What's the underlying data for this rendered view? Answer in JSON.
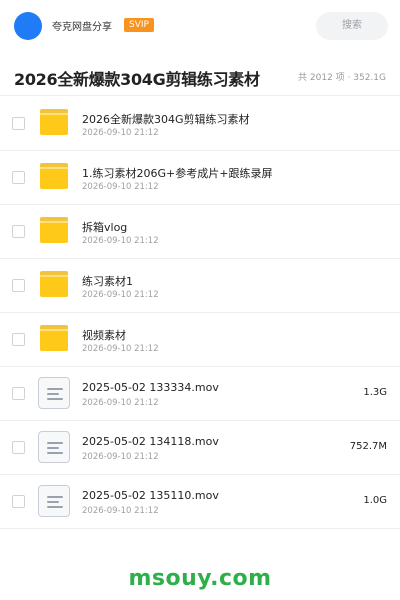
{
  "header": {
    "share_name": "夸克网盘分享",
    "badge": "SVIP",
    "search_label": "搜索"
  },
  "title": "2026全新爆款304G剪辑练习素材",
  "summary": "共 2012 项 · 352.1G",
  "files": [
    {
      "type": "folder",
      "icon": "folder-icon",
      "name": "2026全新爆款304G剪辑练习素材",
      "date": "2026-09-10 21:12",
      "size": ""
    },
    {
      "type": "folder",
      "icon": "folder-icon",
      "name": "1.练习素材206G+参考成片+跟练录屏",
      "date": "2026-09-10 21:12",
      "size": ""
    },
    {
      "type": "folder",
      "icon": "folder-icon",
      "name": "拆箱vlog",
      "date": "2026-09-10 21:12",
      "size": ""
    },
    {
      "type": "folder",
      "icon": "folder-icon",
      "name": "练习素材1",
      "date": "2026-09-10 21:12",
      "size": ""
    },
    {
      "type": "folder",
      "icon": "folder-icon",
      "name": "视频素材",
      "date": "2026-09-10 21:12",
      "size": ""
    },
    {
      "type": "file",
      "icon": "file-icon",
      "name": "2025-05-02 133334.mov",
      "date": "2026-09-10 21:12",
      "size": "1.3G"
    },
    {
      "type": "file",
      "icon": "file-icon",
      "name": "2025-05-02 134118.mov",
      "date": "2026-09-10 21:12",
      "size": "752.7M"
    },
    {
      "type": "file",
      "icon": "file-icon",
      "name": "2025-05-02 135110.mov",
      "date": "2026-09-10 21:12",
      "size": "1.0G"
    }
  ],
  "watermark": "msouy.com",
  "colors": {
    "accent_blue": "#1f7cf6",
    "svip_orange": "#f7931e",
    "folder_yellow": "#ffc91a",
    "watermark_green": "#2eaf4a"
  }
}
